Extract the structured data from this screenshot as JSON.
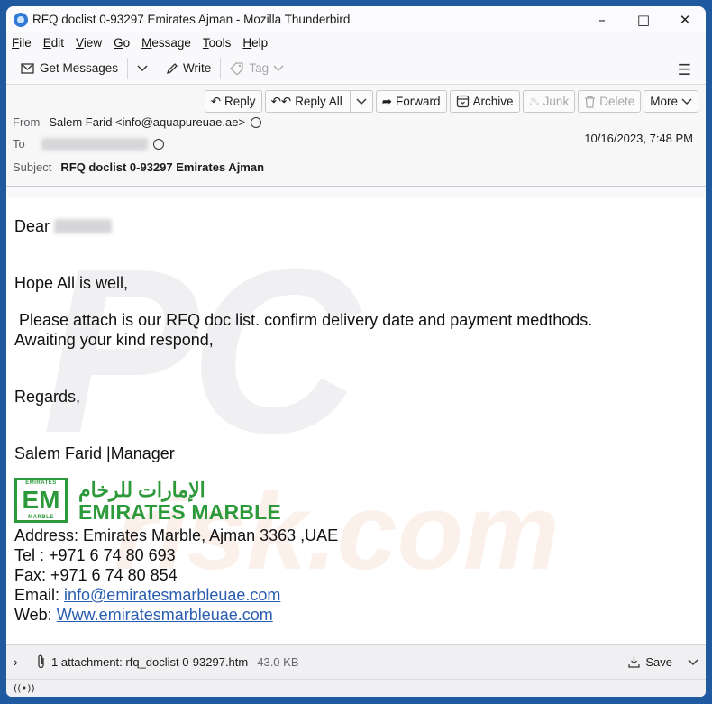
{
  "window": {
    "title": "RFQ doclist 0-93297 Emirates Ajman - Mozilla Thunderbird",
    "icon": "thunderbird-logo-icon",
    "controls": [
      "minimize-icon",
      "maximize-icon",
      "close-icon"
    ]
  },
  "menubar": {
    "items": [
      {
        "label": "File",
        "accel": "F",
        "rest": "ile"
      },
      {
        "label": "Edit",
        "accel": "E",
        "rest": "dit"
      },
      {
        "label": "View",
        "accel": "V",
        "rest": "iew"
      },
      {
        "label": "Go",
        "accel": "G",
        "rest": "o"
      },
      {
        "label": "Message",
        "accel": "M",
        "rest": "essage"
      },
      {
        "label": "Tools",
        "accel": "T",
        "rest": "ools"
      },
      {
        "label": "Help",
        "accel": "H",
        "rest": "elp"
      }
    ]
  },
  "toolbar": {
    "get_messages": "Get Messages",
    "write": "Write",
    "tag": "Tag",
    "menu_icon": "hamburger-menu-icon"
  },
  "message_actions": {
    "reply": "Reply",
    "reply_all": "Reply All",
    "forward": "Forward",
    "archive": "Archive",
    "junk": "Junk",
    "delete": "Delete",
    "more": "More"
  },
  "header": {
    "from_label": "From",
    "from_value": "Salem Farid <info@aquapureuae.ae>",
    "to_label": "To",
    "to_value_redacted": "",
    "date": "10/16/2023, 7:48 PM",
    "subject_label": "Subject",
    "subject_value": "RFQ doclist 0-93297 Emirates Ajman"
  },
  "body": {
    "greeting": "Dear",
    "greeting_name_redacted": "",
    "line1": "Hope All is well,",
    "line2": " Please attach is our RFQ doc list. confirm delivery date and payment medthods.",
    "line3": "Awaiting your kind respond,",
    "regards": "Regards,",
    "signature_name": "Salem Farid |Manager",
    "logo": {
      "box_top": "EMIRATES",
      "box_main": "EM",
      "box_bottom": "MARBLE",
      "arabic": "الإمارات للرخام",
      "english": "EMIRATES MARBLE",
      "color": "#2c9a3a"
    },
    "address": "Address: Emirates Marble, Ajman 3363 ,UAE",
    "tel": "Tel : +971 6 74 80 693",
    "fax": "Fax: +971 6 74 80 854",
    "email_label": "Email: ",
    "email_link": "info@emiratesmarbleuae.com",
    "web_label": "Web: ",
    "web_link": "Www.emiratesmarbleuae.com",
    "watermark_top": "PC",
    "watermark_bottom": "risk.com"
  },
  "attachment": {
    "summary": "1 attachment: rfq_doclist 0-93297.htm",
    "size": "43.0 KB",
    "save": "Save"
  },
  "statusbar": {
    "icon": "connection-status-icon"
  }
}
